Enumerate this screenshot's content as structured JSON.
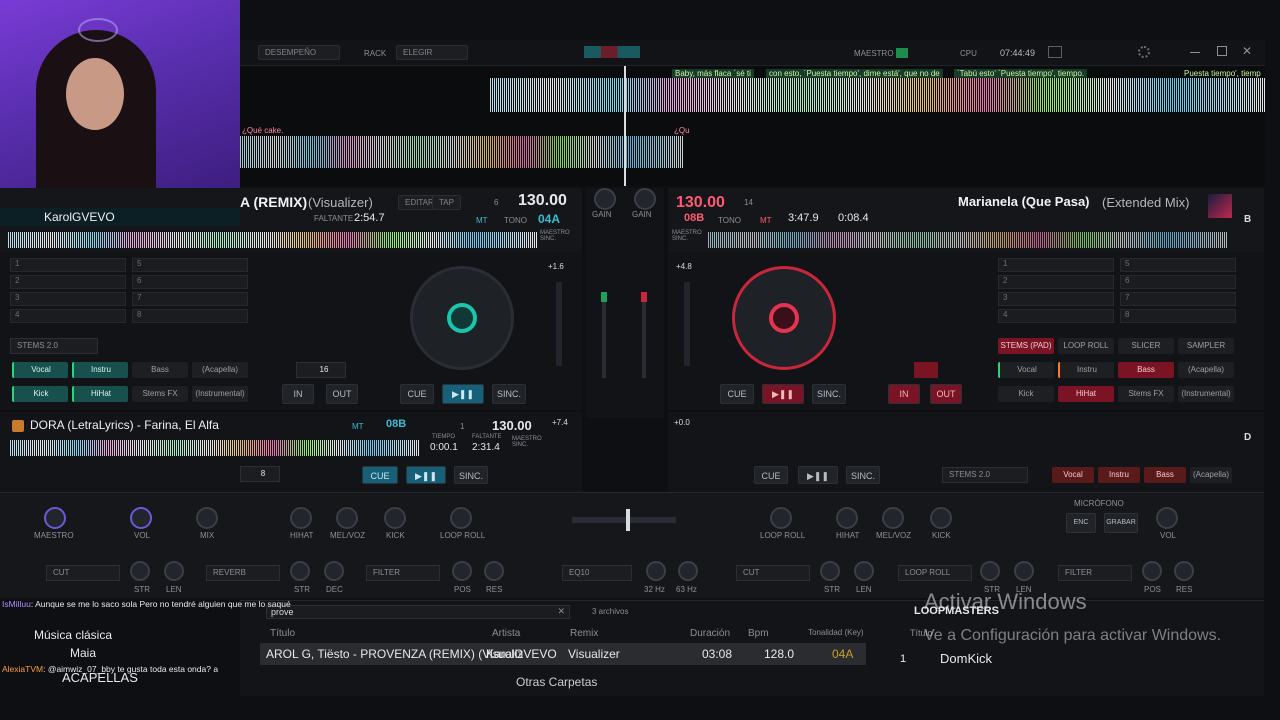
{
  "toolbar": {
    "performance": "DESEMPEÑO",
    "rack": "RACK",
    "choose": "ELEGIR",
    "master": "MAESTRO",
    "cpu": "CPU",
    "clock": "07:44:49"
  },
  "lyrics_top": {
    "l1": "Baby, más flaca ´sé ti",
    "l2": "con esto, ´Puesta tiempo', dime está', que no de",
    "l3": "´Tabú esto' ´Puesta tiempo', tiempo.",
    "l4": "Puesta tiempo', tiemp",
    "l5": "¿Qué cake.",
    "l6": "¿Qu"
  },
  "webcam": {
    "label": "KarolGVEVO"
  },
  "deck_a": {
    "title": "A (REMIX)",
    "sub": "(Visualizer)",
    "remaining_label": "FALTANTE",
    "remaining": "2:54.7",
    "edit": "EDITAR",
    "tap": "TAP",
    "bpm": "130.00",
    "key": "04A",
    "key_mode": "MT",
    "tone": "TONO",
    "beats": "6",
    "pitch": "+1.6",
    "master_sync": "MAESTRO SINC.",
    "loop_size": "16",
    "cue": "CUE",
    "sync": "SINC.",
    "in": "IN",
    "out": "OUT",
    "stems": "STEMS 2.0",
    "stem_vocal": "Vocal",
    "stem_instru": "Instru",
    "stem_bass": "Bass",
    "stem_acapella": "(Acapella)",
    "stem_kick": "Kick",
    "stem_hihat": "HiHat",
    "stem_fx": "Stems FX",
    "stem_instrumental": "(Instrumental)",
    "hotcues": [
      "1",
      "2",
      "3",
      "4",
      "5",
      "6",
      "7",
      "8"
    ]
  },
  "deck_b": {
    "title": "Marianela (Que Pasa)",
    "sub": "(Extended Mix)",
    "bpm": "130.00",
    "key": "08B",
    "beats": "14",
    "key_mode": "MT",
    "tone": "TONO",
    "time1": "3:47.9",
    "time2": "0:08.4",
    "pitch": "+4.8",
    "master_sync": "MAESTRO SINC.",
    "cue": "CUE",
    "sync": "SINC.",
    "in": "IN",
    "out": "OUT",
    "stems_tab": "STEMS (PAD)",
    "loop_roll": "LOOP ROLL",
    "slicer": "SLICER",
    "sampler": "SAMPLER",
    "stem_vocal": "Vocal",
    "stem_instru": "Instru",
    "stem_bass": "Bass",
    "stem_acapella": "(Acapella)",
    "stem_kick": "Kick",
    "stem_hihat": "HiHat",
    "stem_fx": "Stems FX",
    "stem_instrumental": "(Instrumental)",
    "side": "B"
  },
  "deck_c": {
    "title": "DORA (LetraLyrics) - Farina, El Alfa",
    "bpm": "130.00",
    "key": "08B",
    "key_mode": "MT",
    "beats": "1",
    "pitch": "+7.4",
    "time_label": "TIEMPO",
    "remaining_label": "FALTANTE",
    "time": "0:00.1",
    "remaining": "2:31.4",
    "loop": "8",
    "cue": "CUE",
    "sync": "SINC.",
    "master_sync": "MAESTRO SINC."
  },
  "deck_d": {
    "side": "D",
    "pitch": "+0.0",
    "cue": "CUE",
    "sync": "SINC.",
    "stems": "STEMS 2.0",
    "stem_vocal": "Vocal",
    "stem_instru": "Instru",
    "stem_bass": "Bass",
    "stem_acapella": "(Acapella)"
  },
  "mixer": {
    "gain": "GAIN",
    "master": "MAESTRO",
    "vol": "VOL",
    "mix": "MIX",
    "hihat": "HIHAT",
    "melvoz": "MEL/VOZ",
    "kick": "KICK",
    "loop_roll": "LOOP ROLL",
    "microphone": "MICRÓFONO",
    "enc": "ENC",
    "record": "GRABAR",
    "cut": "CUT",
    "reverb": "REVERB",
    "filter": "FILTER",
    "eq10": "EQ10",
    "str": "STR",
    "len": "LEN",
    "dec": "DEC",
    "pos": "POS",
    "res": "RES",
    "hz32": "32 Hz",
    "hz63": "63 Hz"
  },
  "browser": {
    "search": "prove",
    "count": "3 archivos",
    "col_title": "Título",
    "col_artist": "Artista",
    "col_remix": "Remix",
    "col_duration": "Duración",
    "col_bpm": "Bpm",
    "col_key": "Tonalidad (Key)",
    "row_title": "AROL G, Tiësto - PROVENZA (REMIX) (Visualiz",
    "row_artist": "KarolGVEVO",
    "row_remix": "Visualizer",
    "row_duration": "03:08",
    "row_bpm": "128.0",
    "row_key": "04A",
    "other_folders": "Otras Carpetas",
    "acapellas": "ACAPELLAS",
    "loopmasters": "LOOPMASTERS",
    "sidebar_title": "Título",
    "sidebar_row_num": "1",
    "sidebar_row": "DomKick"
  },
  "activation": {
    "title": "Activar Windows",
    "sub": "Ve a Configuración para activar Windows."
  },
  "chat": [
    {
      "user": "IsMilluu",
      "text": ": Aunque se me lo saco sola Pero no tendré alguien que me lo saqué",
      "color": "#b58cff"
    },
    {
      "user": "",
      "text": "Música clásica",
      "color": "#e9e9e9"
    },
    {
      "user": "",
      "text": "Maia",
      "color": "#e9e9e9"
    },
    {
      "user": "AlexiaTVM",
      "text": ": @aimwiz_07_bby te gusta toda esta onda? a",
      "color": "#ff9d3a"
    }
  ]
}
